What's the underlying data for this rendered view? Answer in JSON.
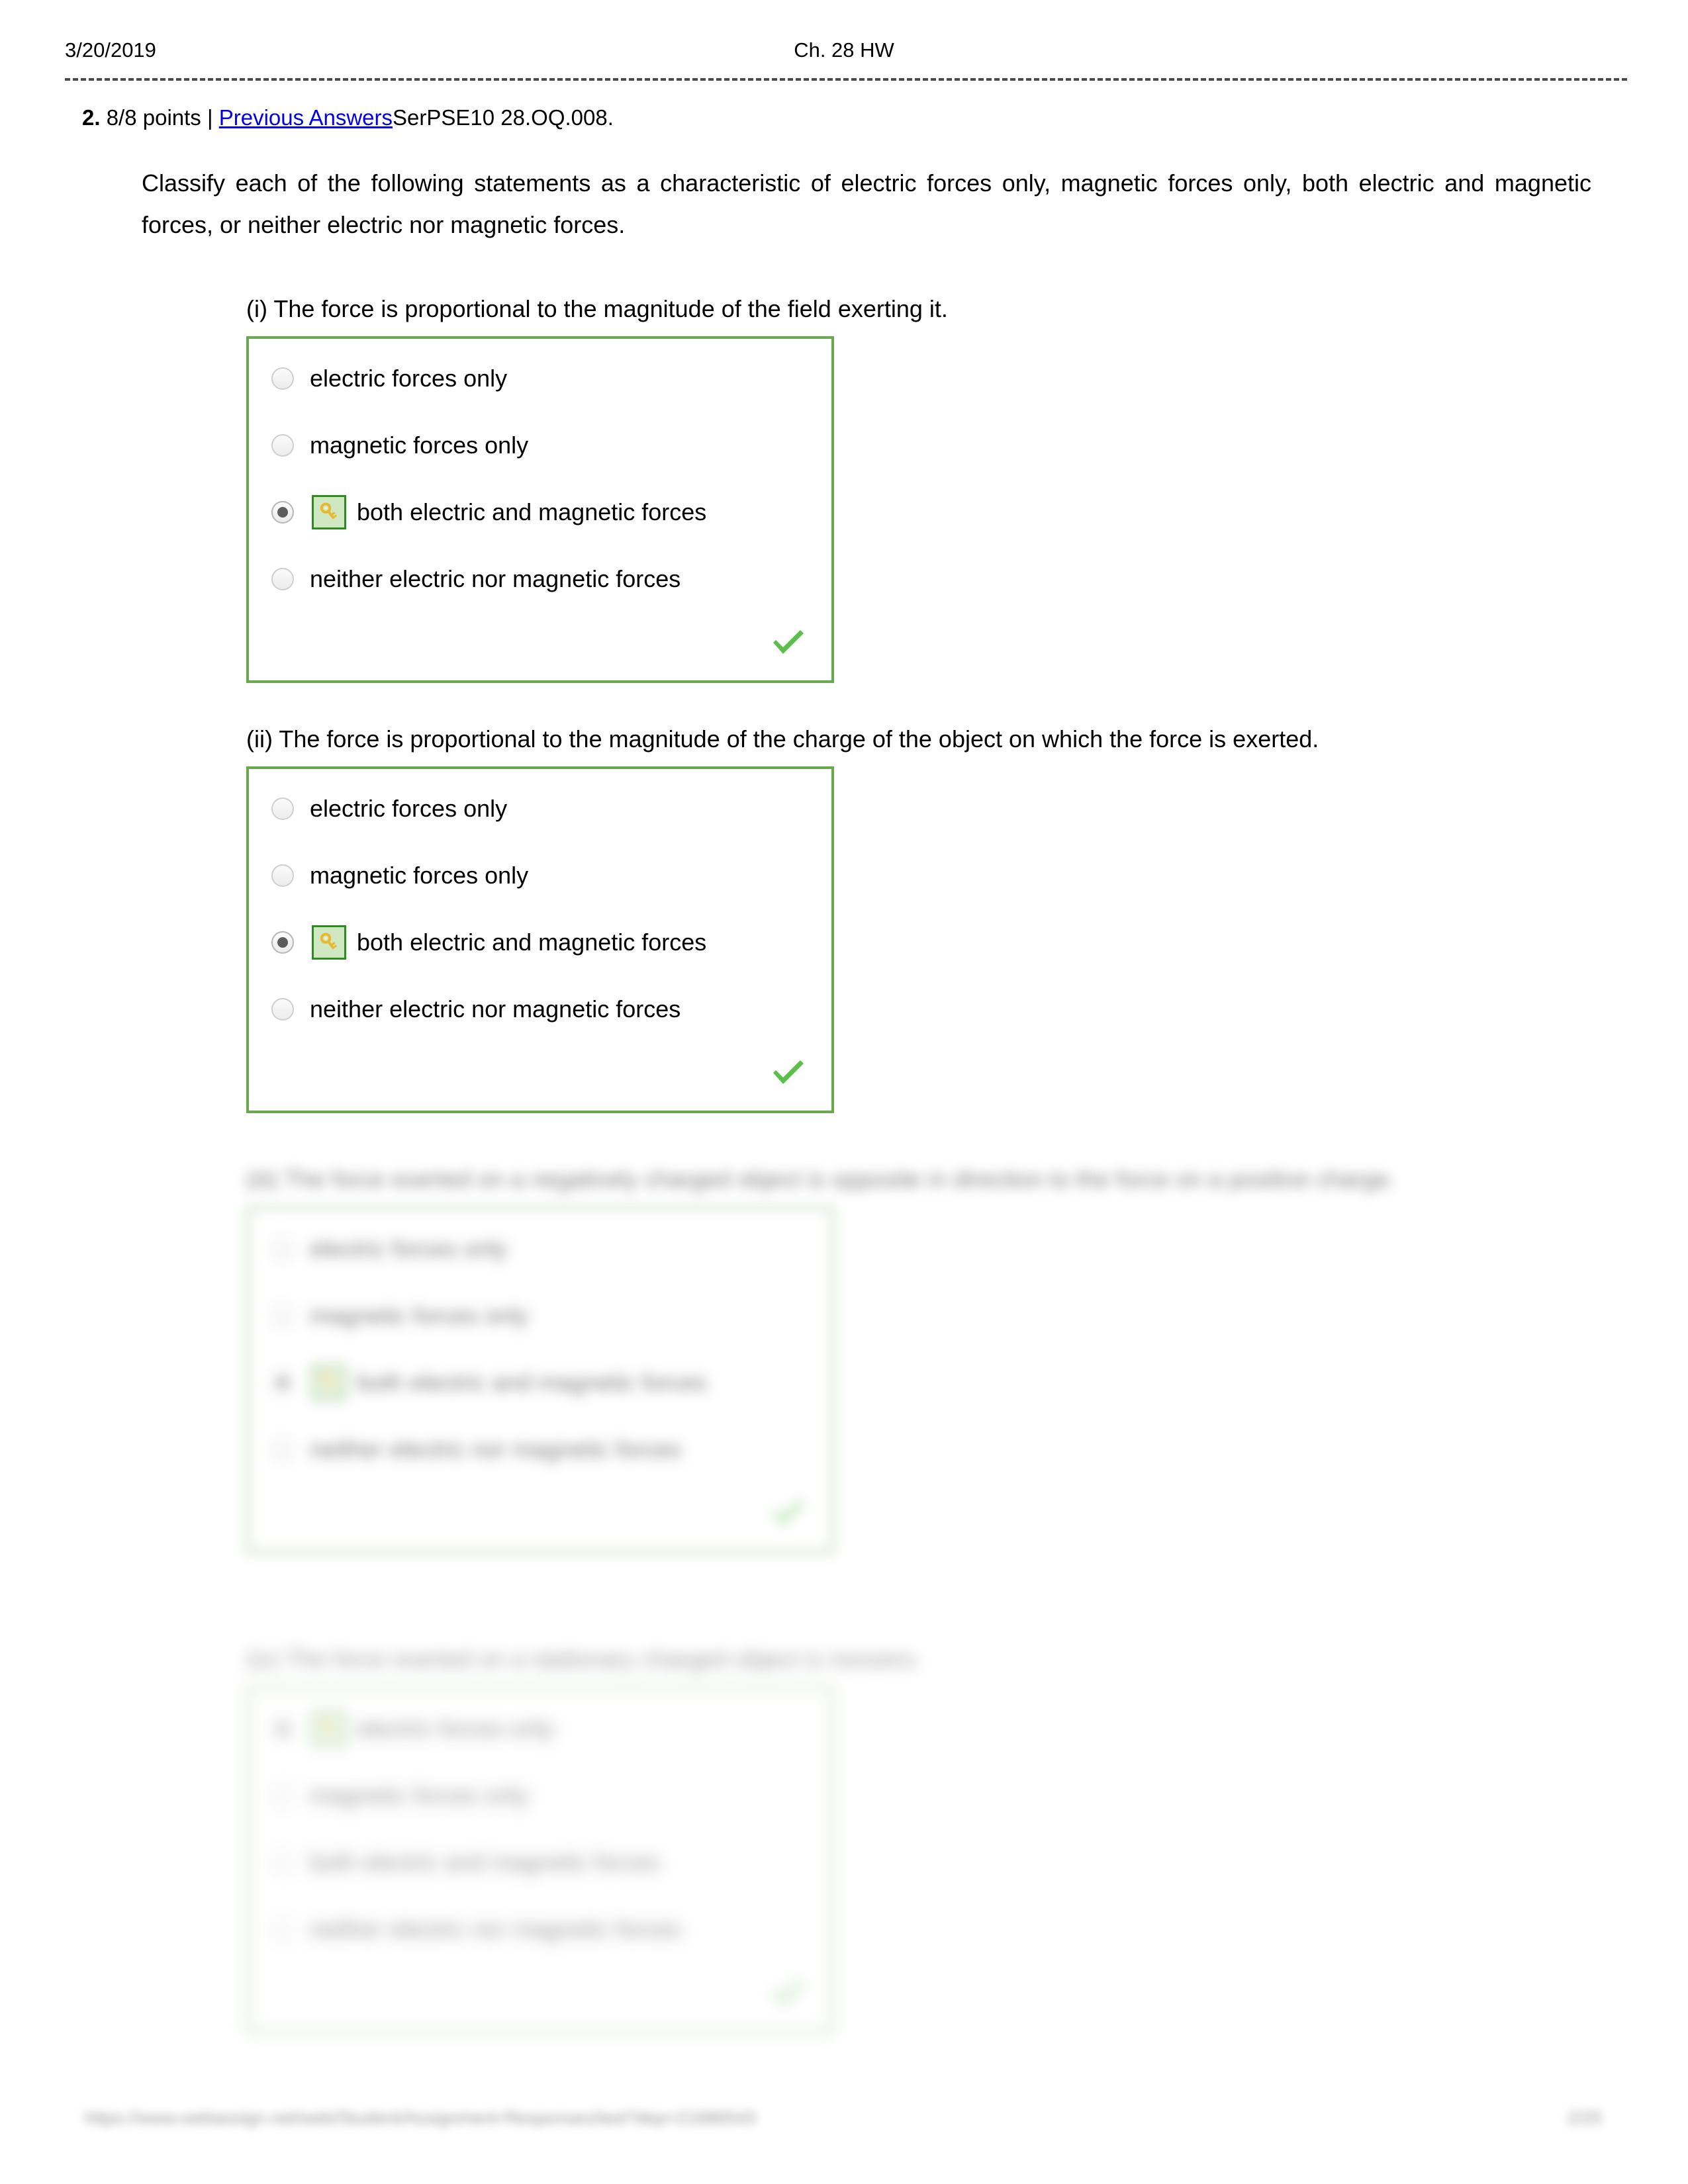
{
  "header": {
    "date": "3/20/2019",
    "title": "Ch. 28 HW"
  },
  "question_meta": {
    "number": "2.",
    "points": "8/8 points",
    "separator": "|",
    "previous_answers_link": "Previous Answers",
    "question_code": "SerPSE10 28.OQ.008."
  },
  "prompt": "Classify each of the following statements as a characteristic of electric forces only, magnetic forces only, both electric and magnetic forces, or neither electric nor magnetic forces.",
  "options_common": [
    "electric forces only",
    "magnetic forces only",
    "both electric and magnetic forces",
    "neither electric nor magnetic forces"
  ],
  "icons": {
    "key": "key-icon",
    "check": "green-check-icon"
  },
  "colors": {
    "box_border": "#6aa84f",
    "key_badge_border": "#2e8b22",
    "key_badge_fill": "#cfe8c2",
    "key_gold": "#e8b92e",
    "check_green": "#5bbf4a",
    "link_blue": "#0000ee",
    "rule_gray": "#4d4d4d"
  },
  "parts": [
    {
      "label": "(i) The force is proportional to the magnitude of the field exerting it.",
      "selected_index": 2,
      "correct": true,
      "blur": "none"
    },
    {
      "label": "(ii) The force is proportional to the magnitude of the charge of the object on which the force is exerted.",
      "selected_index": 2,
      "correct": true,
      "blur": "none"
    },
    {
      "label": "(iii) The force exerted on a negatively charged object is opposite in direction to the force on a positive charge.",
      "selected_index": 2,
      "correct": true,
      "blur": "heavy"
    },
    {
      "label": "(iv) The force exerted on a stationary charged object is nonzero.",
      "selected_index": 0,
      "correct": true,
      "blur": "heavy"
    }
  ],
  "footer": {
    "url": "https://www.webassign.net/web/Student/Assignment-Responses/last?dep=21686543",
    "page": "2/25"
  }
}
